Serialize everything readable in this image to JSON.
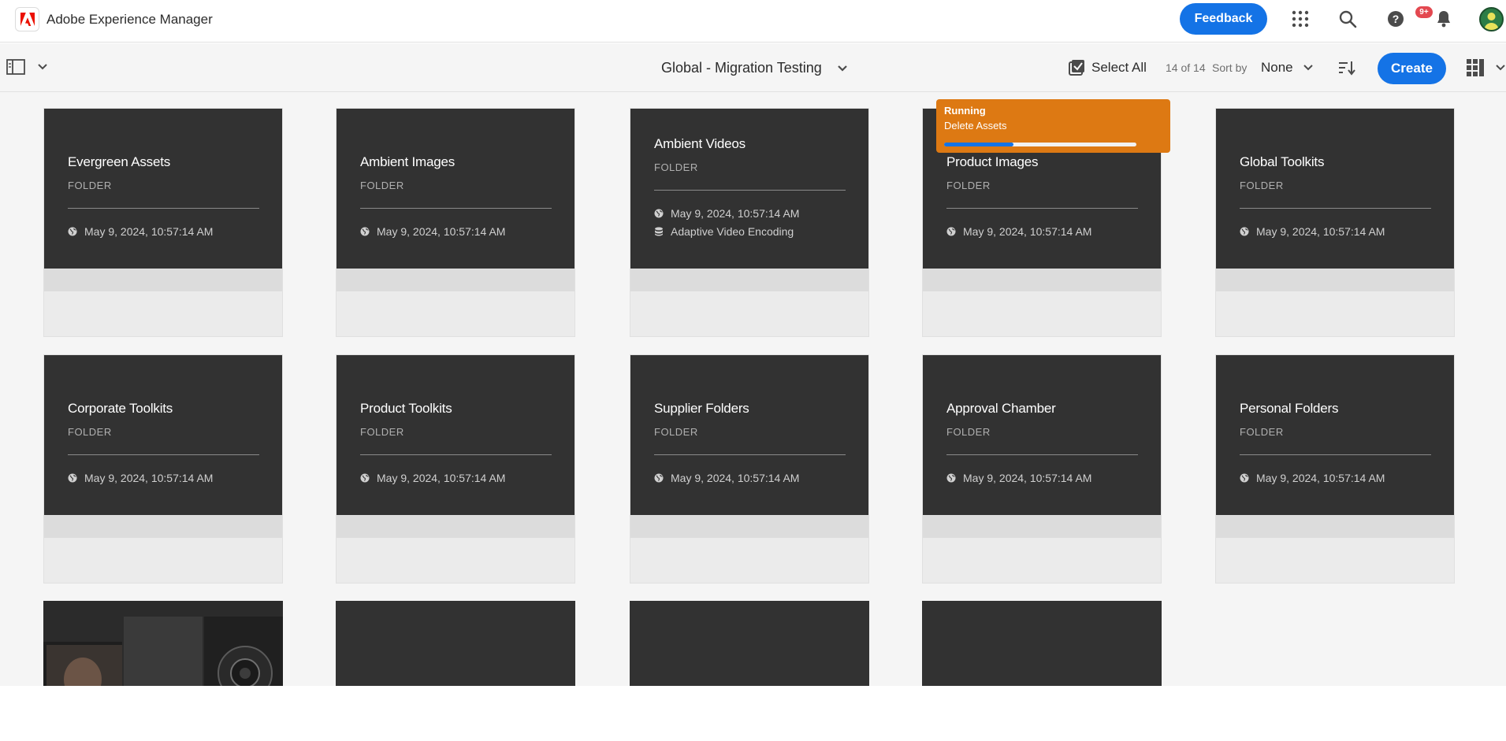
{
  "shell": {
    "app_title": "Adobe Experience Manager",
    "feedback_label": "Feedback",
    "notification_badge": "9+",
    "icons": [
      "adobe-logo-icon",
      "apps-grid-icon",
      "search-icon",
      "help-icon",
      "bell-icon",
      "user-avatar"
    ]
  },
  "actionbar": {
    "title": "Global - Migration Testing",
    "select_all_label": "Select All",
    "count": "14 of 14",
    "sort_by_label": "Sort by",
    "sort_value": "None",
    "create_label": "Create"
  },
  "job": {
    "status": "Running",
    "name": "Delete Assets",
    "progress_fraction": 0.36
  },
  "cards": [
    {
      "title": "Evergreen Assets",
      "type": "FOLDER",
      "modified": "May 9, 2024, 10:57:14 AM"
    },
    {
      "title": "Ambient Images",
      "type": "FOLDER",
      "modified": "May 9, 2024, 10:57:14 AM"
    },
    {
      "title": "Ambient Videos",
      "type": "FOLDER",
      "modified": "May 9, 2024, 10:57:14 AM",
      "profile": "Adaptive Video Encoding"
    },
    {
      "title": "Product Images",
      "type": "FOLDER",
      "modified": "May 9, 2024, 10:57:14 AM"
    },
    {
      "title": "Global Toolkits",
      "type": "FOLDER",
      "modified": "May 9, 2024, 10:57:14 AM"
    },
    {
      "title": "Corporate Toolkits",
      "type": "FOLDER",
      "modified": "May 9, 2024, 10:57:14 AM"
    },
    {
      "title": "Product Toolkits",
      "type": "FOLDER",
      "modified": "May 9, 2024, 10:57:14 AM"
    },
    {
      "title": "Supplier Folders",
      "type": "FOLDER",
      "modified": "May 9, 2024, 10:57:14 AM"
    },
    {
      "title": "Approval Chamber",
      "type": "FOLDER",
      "modified": "May 9, 2024, 10:57:14 AM"
    },
    {
      "title": "Personal Folders",
      "type": "FOLDER",
      "modified": "May 9, 2024, 10:57:14 AM"
    }
  ],
  "colors": {
    "accent": "#1473e6",
    "job_background": "#dd7913",
    "card_thumb": "#323232",
    "notification": "#e34850"
  }
}
